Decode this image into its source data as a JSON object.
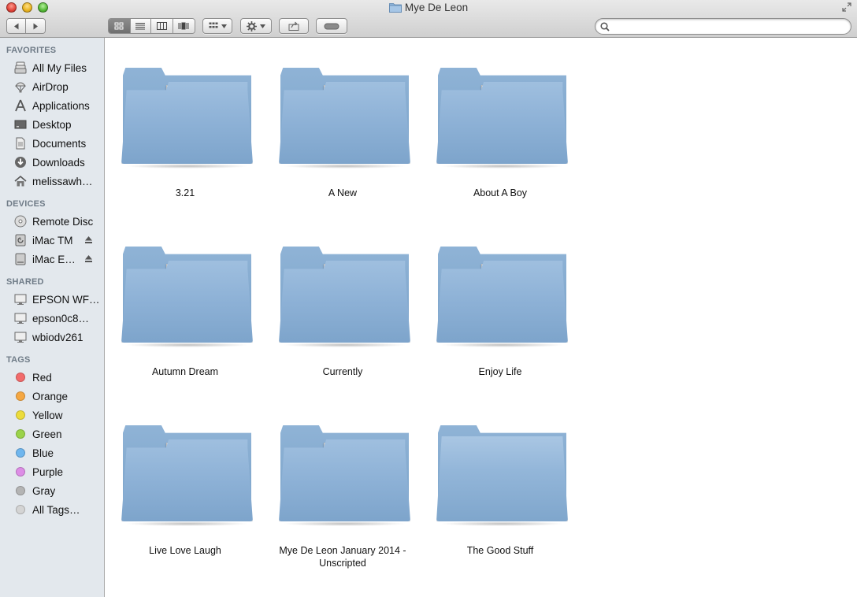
{
  "window": {
    "title": "Mye De Leon"
  },
  "toolbar": {
    "back_icon": "chevron-left-icon",
    "forward_icon": "chevron-right-icon",
    "views": [
      "icon-view",
      "list-view",
      "column-view",
      "cover-flow-view"
    ],
    "active_view": "icon-view",
    "search_placeholder": ""
  },
  "sidebar": {
    "favorites_header": "FAVORITES",
    "favorites": [
      {
        "label": "All My Files",
        "icon": "all-files-icon"
      },
      {
        "label": "AirDrop",
        "icon": "airdrop-icon"
      },
      {
        "label": "Applications",
        "icon": "applications-icon"
      },
      {
        "label": "Desktop",
        "icon": "desktop-icon"
      },
      {
        "label": "Documents",
        "icon": "documents-icon"
      },
      {
        "label": "Downloads",
        "icon": "downloads-icon"
      },
      {
        "label": "melissawh…",
        "icon": "home-icon"
      }
    ],
    "devices_header": "DEVICES",
    "devices": [
      {
        "label": "Remote Disc",
        "icon": "disc-icon"
      },
      {
        "label": "iMac TM",
        "icon": "drive-icon"
      },
      {
        "label": "iMac E…",
        "icon": "drive-icon"
      }
    ],
    "shared_header": "SHARED",
    "shared": [
      {
        "label": "EPSON WF…",
        "icon": "monitor-icon"
      },
      {
        "label": "epson0c8…",
        "icon": "monitor-icon"
      },
      {
        "label": "wbiodv261",
        "icon": "monitor-icon"
      }
    ],
    "tags_header": "TAGS",
    "tags": [
      {
        "label": "Red",
        "color": "#f26b6b"
      },
      {
        "label": "Orange",
        "color": "#f5a742"
      },
      {
        "label": "Yellow",
        "color": "#ecdc3c"
      },
      {
        "label": "Green",
        "color": "#9bd34a"
      },
      {
        "label": "Blue",
        "color": "#6fb6ee"
      },
      {
        "label": "Purple",
        "color": "#dd8de6"
      },
      {
        "label": "Gray",
        "color": "#b4b4b4"
      },
      {
        "label": "All Tags…",
        "color": "#d4d4d4"
      }
    ]
  },
  "folders": [
    {
      "name": "3.21",
      "palette": [
        "#d35f5f",
        "#f0b35a",
        "#6fb3c5",
        "#333333",
        "#e9e0c9",
        "#c44d7a"
      ]
    },
    {
      "name": "A New",
      "palette": [
        "#6cb6b0",
        "#e88c5b",
        "#f2c9a0",
        "#9e9e9e",
        "#4f8fa1",
        "#e9e3d2"
      ]
    },
    {
      "name": "About A Boy",
      "palette": [
        "#c0392b",
        "#2e7d6b",
        "#5a5a5a",
        "#e2c25c",
        "#7fb7c9",
        "#d98b4b"
      ]
    },
    {
      "name": "Autumn Dream",
      "palette": [
        "#7a3a6b",
        "#e2a13b",
        "#3e8b8b",
        "#c9c9a4",
        "#5d4b8e",
        "#d8d0a8"
      ]
    },
    {
      "name": "Currently",
      "palette": [
        "#c85c47",
        "#3f8a7e",
        "#e6e1d4",
        "#2e2e2e",
        "#d9a56b",
        "#8ab3a8"
      ]
    },
    {
      "name": "Enjoy Life",
      "palette": [
        "#d2346f",
        "#2b2b2b",
        "#6aa7b8",
        "#f1f1f1",
        "#a0a0a0",
        "#e5708f"
      ]
    },
    {
      "name": "Live Love Laugh",
      "palette": [
        "#e6a23c",
        "#5fa8b8",
        "#d95c5c",
        "#3a3a3a",
        "#f0e6d0",
        "#8a6b4b"
      ]
    },
    {
      "name": "Mye De Leon January 2014 - Unscripted",
      "palette": [
        "#e7e7e7",
        "#6a6a6a",
        "#c8a46a",
        "#9cb9c8",
        "#3a3a3a",
        "#d6d0c4"
      ]
    },
    {
      "name": "The Good Stuff",
      "palette": []
    }
  ]
}
